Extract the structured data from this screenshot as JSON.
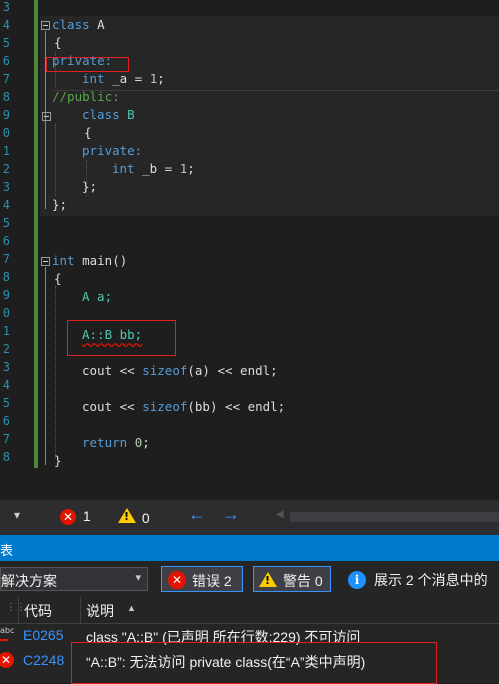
{
  "editor": {
    "line_numbers": [
      "3",
      "4",
      "5",
      "6",
      "7",
      "8",
      "9",
      "0",
      "1",
      "2",
      "3",
      "4",
      "5",
      "6",
      "7",
      "8",
      "9",
      "0",
      "1",
      "2",
      "3",
      "4",
      "5",
      "6",
      "7",
      "8"
    ],
    "code": {
      "l24_kw": "class",
      "l24_name": " A",
      "l25": "{",
      "l26": "private:",
      "l27_kw": "int",
      "l27_rest": " _a = ",
      "l27_num": "1",
      "l27_end": ";",
      "l28": "//public:",
      "l29_kw": "class",
      "l29_name": " B",
      "l30": "{",
      "l31": "private:",
      "l32_kw": "int",
      "l32_rest": " _b = ",
      "l32_num": "1",
      "l32_end": ";",
      "l33": "};",
      "l34": "};",
      "l37_kw": "int",
      "l37_rest": " main()",
      "l38": "{",
      "l39": "A a;",
      "l41": "A::B bb;",
      "l43_a": "cout << ",
      "l43_kw": "sizeof",
      "l43_b": "(a) << endl;",
      "l45_a": "cout << ",
      "l45_kw": "sizeof",
      "l45_b": "(bb) << endl;",
      "l47_kw": "return",
      "l47_rest": " ",
      "l47_num": "0",
      "l47_end": ";",
      "l48": "}"
    }
  },
  "statusbar": {
    "dropdown_arrow": "▾",
    "error_count": "1",
    "warning_count": "0",
    "back_icon": "←",
    "forward_icon": "→",
    "scroll_left_icon": "◀"
  },
  "panel": {
    "title": "表",
    "scope_select": "解决方案",
    "errors_filter": "错误 2",
    "warnings_filter": "警告 0",
    "messages_filter": "展示 2 个消息中的",
    "col_code": "代码",
    "col_desc": "说明",
    "rows": [
      {
        "code": "E0265",
        "desc": "class \"A::B\" (已声明 所在行数:229) 不可访问",
        "icon": "abc"
      },
      {
        "code": "C2248",
        "desc": "“A::B”: 无法访问 private class(在“A”类中声明)",
        "icon": "error"
      }
    ]
  },
  "colors": {
    "keyword": "#569cd6",
    "comment": "#57a64a",
    "number": "#b5cea8",
    "error_red": "#e51400",
    "accent_blue": "#007acc"
  }
}
